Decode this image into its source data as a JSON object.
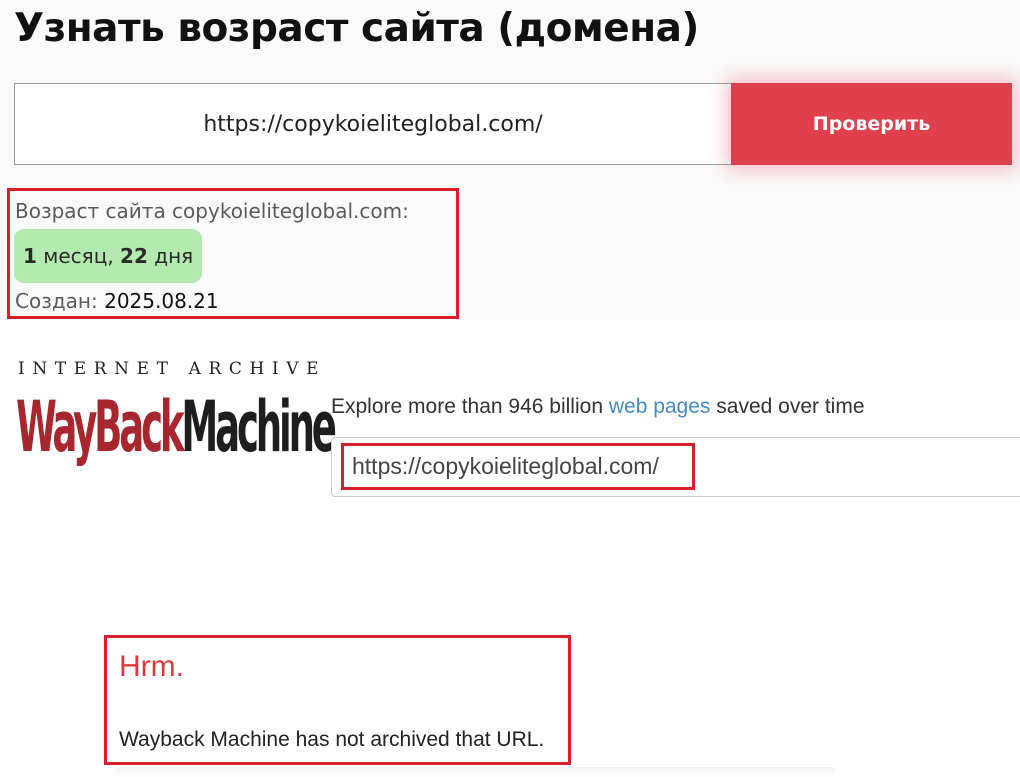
{
  "checker": {
    "title": "Узнать возраст сайта (домена)",
    "url_value": "https://copykoieliteglobal.com/",
    "button_label": "Проверить",
    "result": {
      "label": "Возраст сайта copykoieliteglobal.com:",
      "age": {
        "months": "1",
        "months_word": "месяц,",
        "days": "22",
        "days_word": "дня"
      },
      "created_label": "Создан:",
      "created_value": "2025.08.21"
    }
  },
  "wayback": {
    "logo": {
      "line1": "INTERNET ARCHIVE",
      "word1": "WayBack",
      "word2": "Machine"
    },
    "tagline": {
      "before": "Explore more than 946 billion",
      "link": "web pages",
      "after": "saved over time"
    },
    "search_value": "https://copykoieliteglobal.com/",
    "notice": {
      "title": "Hrm.",
      "text": "Wayback Machine has not archived that URL."
    }
  },
  "colors": {
    "button": "#e0404e",
    "highlight_border": "#d8202c",
    "age_badge": "#b3eab0",
    "wayback_red": "#a8262e",
    "link_blue": "#428bca",
    "notice_title": "#e0363d"
  },
  "icons": []
}
